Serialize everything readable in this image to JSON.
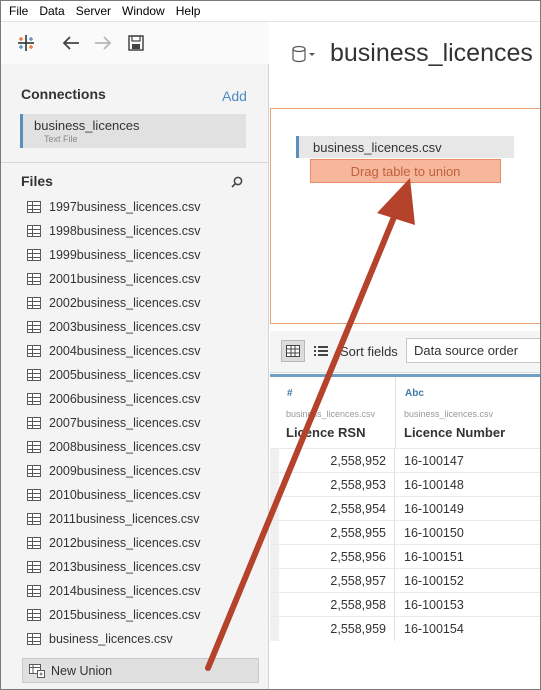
{
  "menu": [
    "File",
    "Data",
    "Server",
    "Window",
    "Help"
  ],
  "connections": {
    "title": "Connections",
    "add_label": "Add",
    "items": [
      {
        "name": "business_licences",
        "type": "Text File"
      }
    ]
  },
  "files": {
    "title": "Files",
    "items": [
      "1997business_licences.csv",
      "1998business_licences.csv",
      "1999business_licences.csv",
      "2001business_licences.csv",
      "2002business_licences.csv",
      "2003business_licences.csv",
      "2004business_licences.csv",
      "2005business_licences.csv",
      "2006business_licences.csv",
      "2007business_licences.csv",
      "2008business_licences.csv",
      "2009business_licences.csv",
      "2010business_licences.csv",
      "2011business_licences.csv",
      "2012business_licences.csv",
      "2013business_licences.csv",
      "2014business_licences.csv",
      "2015business_licences.csv",
      "business_licences.csv"
    ],
    "new_union_label": "New Union"
  },
  "datasource": {
    "title": "business_licences"
  },
  "canvas": {
    "table_name": "business_licences.csv",
    "drop_target_label": "Drag table to union"
  },
  "grid_toolbar": {
    "sort_label": "Sort fields",
    "sort_value": "Data source order"
  },
  "grid": {
    "columns": [
      {
        "type_icon": "#",
        "source": "business_licences.csv",
        "name": "Licence RSN"
      },
      {
        "type_icon": "Abc",
        "source": "business_licences.csv",
        "name": "Licence Number"
      }
    ],
    "rows": [
      [
        "2,558,952",
        "16-100147"
      ],
      [
        "2,558,953",
        "16-100148"
      ],
      [
        "2,558,954",
        "16-100149"
      ],
      [
        "2,558,955",
        "16-100150"
      ],
      [
        "2,558,956",
        "16-100151"
      ],
      [
        "2,558,957",
        "16-100152"
      ],
      [
        "2,558,958",
        "16-100153"
      ],
      [
        "2,558,959",
        "16-100154"
      ]
    ]
  },
  "colors": {
    "accent_blue": "#5b8fb9",
    "drop_target_fill": "#f7b79c",
    "annotation_arrow": "#b5422b"
  }
}
